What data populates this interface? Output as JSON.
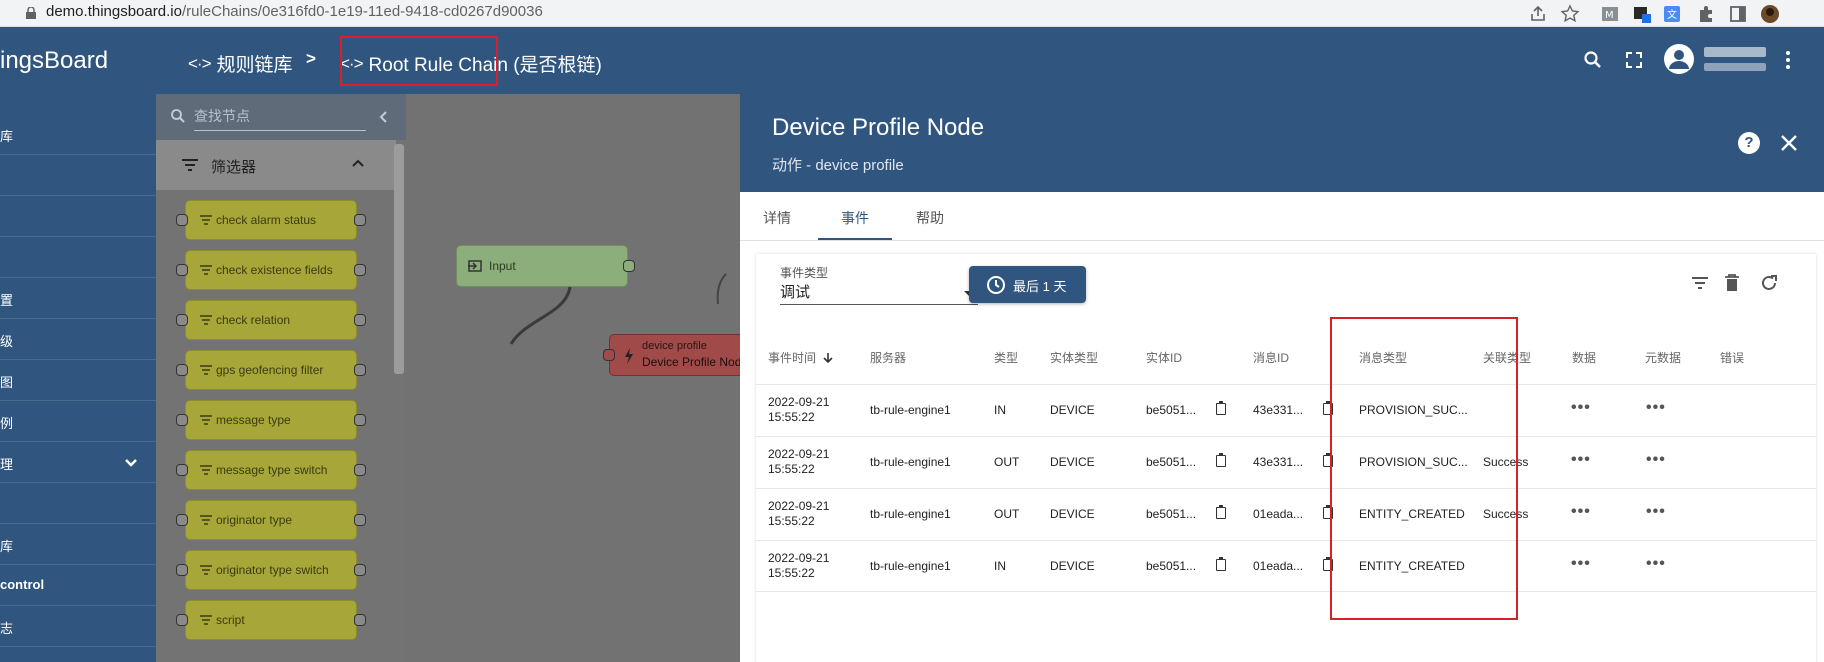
{
  "browser": {
    "url_host": "demo.thingsboard.io",
    "url_path": "/ruleChains/0e316fd0-1e19-11ed-9418-cd0267d90036"
  },
  "header": {
    "logo": "ingsBoard",
    "breadcrumb_library": "规则链库",
    "breadcrumb_sep": ">",
    "breadcrumb_current": "Root Rule Chain (是否根链)"
  },
  "sidebar": {
    "items": [
      "库",
      "",
      "",
      "",
      "置",
      "级",
      "图",
      "例",
      "理",
      "",
      "库",
      "control",
      "志"
    ]
  },
  "library": {
    "search_placeholder": "查找节点",
    "section_title": "筛选器",
    "nodes": [
      "check alarm status",
      "check existence fields",
      "check relation",
      "gps geofencing filter",
      "message type",
      "message type switch",
      "originator type",
      "originator type switch",
      "script"
    ]
  },
  "canvas": {
    "input_label": "Input",
    "node_type": "device profile",
    "node_name": "Device Profile Nod"
  },
  "panel": {
    "title": "Device Profile Node",
    "subtitle": "动作 - device profile",
    "tabs": [
      "详情",
      "事件",
      "帮助"
    ],
    "active_tab": "事件",
    "event_type_label": "事件类型",
    "event_type_value": "调试",
    "time_button": "最后 1 天",
    "columns": [
      "事件时间",
      "服务器",
      "类型",
      "实体类型",
      "实体ID",
      "消息ID",
      "消息类型",
      "关联类型",
      "数据",
      "元数据",
      "错误"
    ],
    "rows": [
      {
        "time1": "2022-09-21",
        "time2": "15:55:22",
        "server": "tb-rule-engine1",
        "type": "IN",
        "entity_type": "DEVICE",
        "entity_id": "be5051...",
        "msg_id": "43e331...",
        "msg_type": "PROVISION_SUC...",
        "relation": ""
      },
      {
        "time1": "2022-09-21",
        "time2": "15:55:22",
        "server": "tb-rule-engine1",
        "type": "OUT",
        "entity_type": "DEVICE",
        "entity_id": "be5051...",
        "msg_id": "43e331...",
        "msg_type": "PROVISION_SUC...",
        "relation": "Success"
      },
      {
        "time1": "2022-09-21",
        "time2": "15:55:22",
        "server": "tb-rule-engine1",
        "type": "OUT",
        "entity_type": "DEVICE",
        "entity_id": "be5051...",
        "msg_id": "01eada...",
        "msg_type": "ENTITY_CREATED",
        "relation": "Success"
      },
      {
        "time1": "2022-09-21",
        "time2": "15:55:22",
        "server": "tb-rule-engine1",
        "type": "IN",
        "entity_type": "DEVICE",
        "entity_id": "be5051...",
        "msg_id": "01eada...",
        "msg_type": "ENTITY_CREATED",
        "relation": ""
      }
    ],
    "more_glyph": "•••"
  },
  "colors": {
    "brand": "#305680",
    "highlight": "#d8202a",
    "filter_node": "#a6a639"
  }
}
